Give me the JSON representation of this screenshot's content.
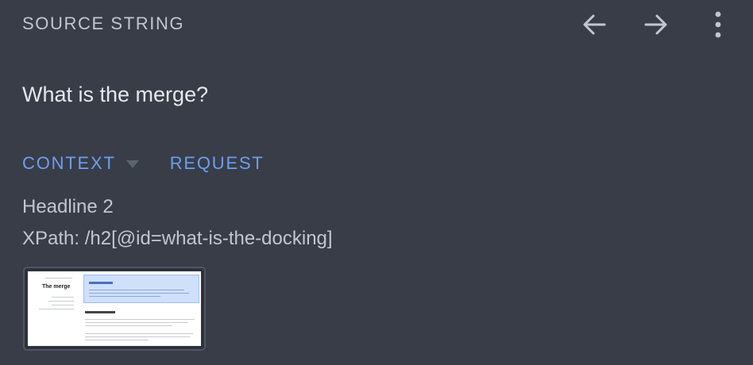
{
  "header": {
    "title": "SOURCE STRING",
    "prev_icon": "arrow-left-icon",
    "next_icon": "arrow-right-icon",
    "menu_icon": "more-vert-icon"
  },
  "source": {
    "text": "What is the merge?"
  },
  "tabs": {
    "context_label": "CONTEXT",
    "request_label": "REQUEST"
  },
  "context": {
    "headline": "Headline 2",
    "xpath": "XPath: /h2[@id=what-is-the-docking]"
  },
  "screenshot": {
    "page_title": "The merge"
  },
  "colors": {
    "background": "#383d48",
    "accent": "#6d9ef0",
    "text": "#c2c6ce"
  }
}
